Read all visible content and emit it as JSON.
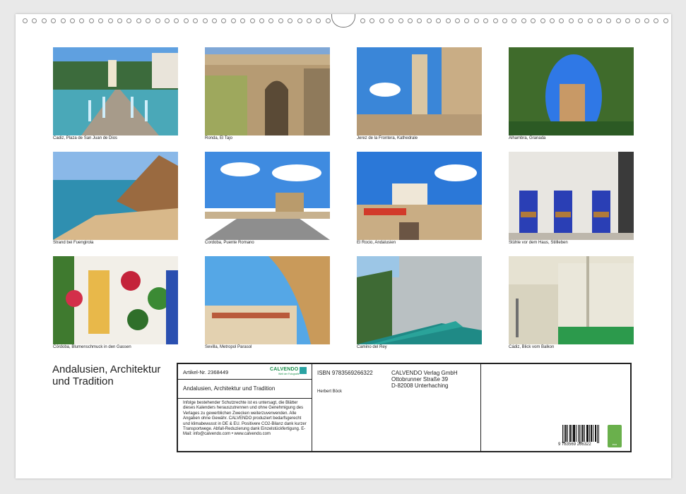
{
  "calendar": {
    "title": "Andalusien, Architektur und Tradition",
    "photos": [
      {
        "caption": "Cadiz, Plaza de San Juan de Dios"
      },
      {
        "caption": "Ronda, El Tajo"
      },
      {
        "caption": "Jerez de la Frontera, Kathedrale"
      },
      {
        "caption": "Alhambra, Granada"
      },
      {
        "caption": "Strand bei Fuengirola"
      },
      {
        "caption": "Cordoba, Puente Romano"
      },
      {
        "caption": "El Rocio, Andalusien"
      },
      {
        "caption": "Stühle vor dem Haus, Stillleben"
      },
      {
        "caption": "Córdoba, Blumenschmuck in den Gassen"
      },
      {
        "caption": "Sevilla, Metropol Parasol"
      },
      {
        "caption": "Camino del Rey"
      },
      {
        "caption": "Cádiz, Blick vom Balkon"
      }
    ]
  },
  "info": {
    "article": "Artikel-Nr. 2368449",
    "brand": "CALVENDO",
    "brand_sub": "Welt der Fotografie",
    "product_title": "Andalusien, Architektur und Tradition",
    "legal": "Infolge bestehender Schutzrechte ist es untersagt, die Blätter dieses Kalenders herauszutrennen und ohne Genehmigung des Verlages zu gewerblichen Zwecken weiterzuverwenden. Alle Angaben ohne Gewähr. CALVENDO produziert bedarfsgerecht und klimabewusst in DE & EU. Positivere CO2-Bilanz dank kurzer Transportwege. Abfall-Reduzierung dank Einzelstückfertigung. E-Mail: info@calvendo.com • www.calvendo.com",
    "isbn": "ISBN 9783569266322",
    "author": "Herbert Böck",
    "publisher_line1": "CALVENDO Verlag GmbH",
    "publisher_line2": "Ottobrunner Straße 39",
    "publisher_line3": "D-82008 Unterhaching",
    "barcode_number": "9 783569 266322",
    "eco_label": "eco"
  }
}
